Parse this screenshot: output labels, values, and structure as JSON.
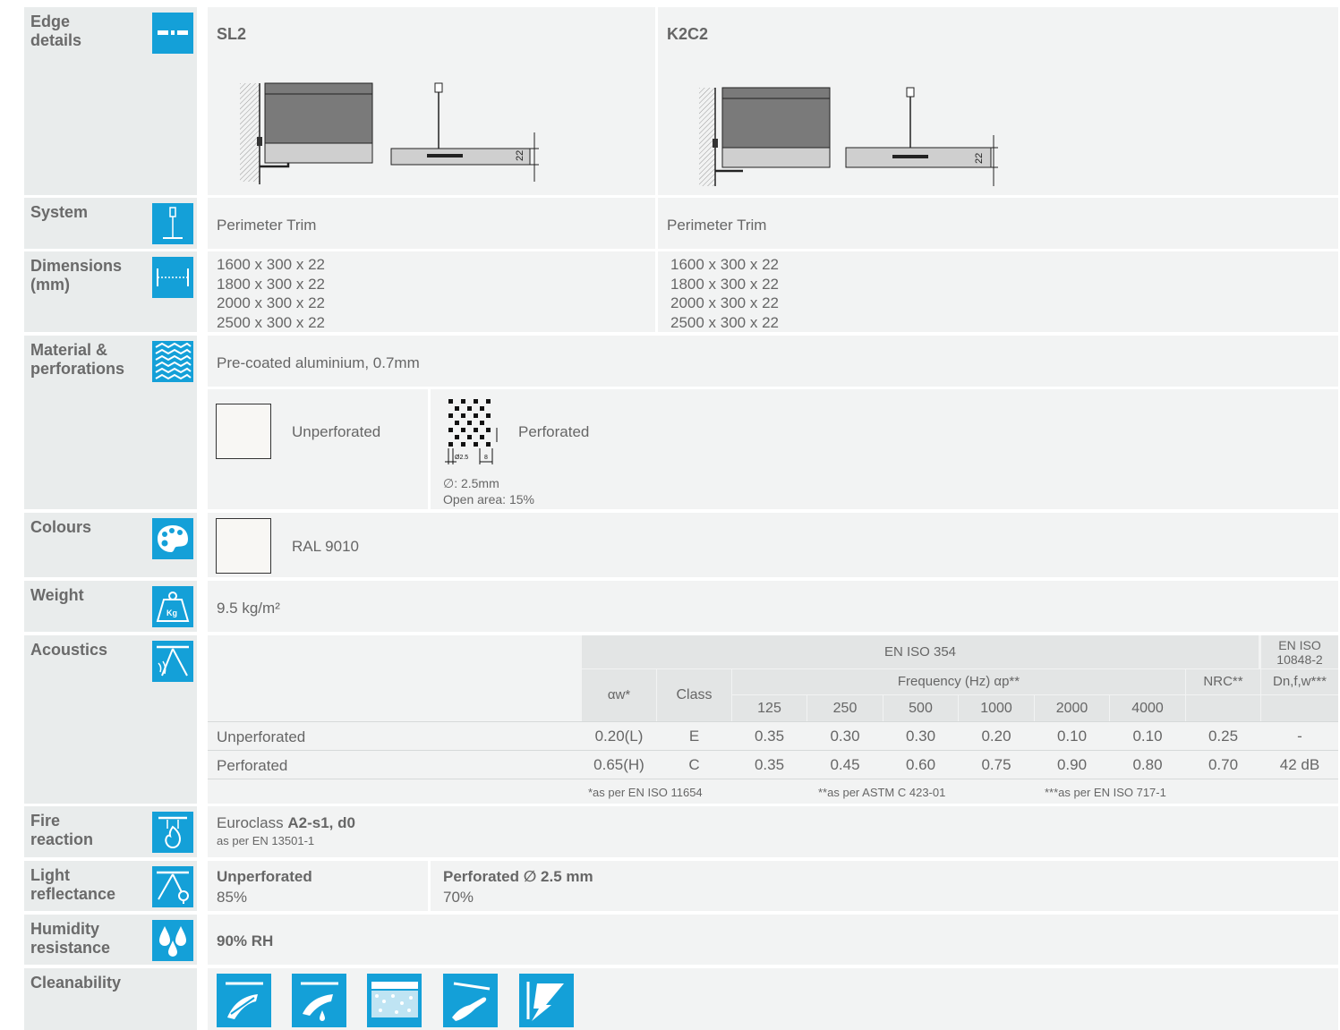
{
  "rows": {
    "edge": {
      "label": "Edge\ndetails",
      "icon": "edge-icon"
    },
    "system": {
      "label": "System",
      "icon": "hanger-icon"
    },
    "dimensions": {
      "label": "Dimensions\n(mm)",
      "icon": "ruler-icon"
    },
    "material": {
      "label": "Material &\nperforations",
      "icon": "perforation-pattern-icon"
    },
    "colours": {
      "label": "Colours",
      "icon": "palette-icon"
    },
    "weight": {
      "label": "Weight",
      "icon": "weight-kg-icon"
    },
    "acoustics": {
      "label": "Acoustics",
      "icon": "acoustics-icon"
    },
    "fire": {
      "label": "Fire\nreaction",
      "icon": "fire-icon"
    },
    "light": {
      "label": "Light\nreflectance",
      "icon": "light-icon"
    },
    "humidity": {
      "label": "Humidity\nresistance",
      "icon": "drops-icon"
    },
    "cleanability": {
      "label": "Cleanability"
    }
  },
  "edge": {
    "sl2": {
      "title": "SL2",
      "dim": "22"
    },
    "k2c2": {
      "title": "K2C2",
      "dim": "22"
    }
  },
  "system": {
    "sl2": "Perimeter Trim",
    "k2c2": "Perimeter Trim"
  },
  "dimensions": {
    "sl2": [
      "1600 x 300 x 22",
      "1800 x 300 x 22",
      "2000 x 300 x 22",
      "2500 x 300 x 22"
    ],
    "k2c2": [
      "1600 x 300 x 22",
      "1800 x 300 x 22",
      "2000 x 300 x 22",
      "2500 x 300 x 22"
    ]
  },
  "material": {
    "text": "Pre-coated aluminium, 0.7mm",
    "unperforated": "Unperforated",
    "perforated": "Perforated",
    "diameter": "∅: 2.5mm",
    "open_area": "Open area: 15%",
    "dim_d": "Ø2.5",
    "dim_pitch": "8"
  },
  "colours": {
    "name": "RAL 9010",
    "swatch": "#f8f7f4"
  },
  "weight": {
    "value": "9.5 kg/m²"
  },
  "acoustics": {
    "standard_354": "EN ISO 354",
    "standard_10848": "EN ISO\n10848-2",
    "alpha_w": "αw*",
    "class": "Class",
    "frequency": "Frequency (Hz) αp**",
    "nrc": "NRC**",
    "dnfw": "Dn,f,w***",
    "freqs": [
      "125",
      "250",
      "500",
      "1000",
      "2000",
      "4000"
    ],
    "rows": [
      {
        "name": "Unperforated",
        "aw": "0.20(L)",
        "cls": "E",
        "vals": [
          "0.35",
          "0.30",
          "0.30",
          "0.20",
          "0.10",
          "0.10"
        ],
        "nrc": "0.25",
        "dnfw": "-"
      },
      {
        "name": "Perforated",
        "aw": "0.65(H)",
        "cls": "C",
        "vals": [
          "0.35",
          "0.45",
          "0.60",
          "0.75",
          "0.90",
          "0.80"
        ],
        "nrc": "0.70",
        "dnfw": "42 dB"
      }
    ],
    "foot1": "*as per EN ISO 11654",
    "foot2": "**as per ASTM C 423-01",
    "foot3": "***as per EN ISO 717-1"
  },
  "fire": {
    "prefix": "Euroclass ",
    "value": "A2-s1, d0",
    "sub": "as per EN 13501-1"
  },
  "light": {
    "unperf_label": "Unperforated",
    "unperf_value": "85%",
    "perf_label": "Perforated ∅ 2.5 mm",
    "perf_value": "70%"
  },
  "humidity": {
    "value": "90% RH"
  },
  "cleanability": {
    "icons": [
      "dry-cloth-icon",
      "damp-cloth-icon",
      "brush-icon",
      "hand-wipe-icon",
      "impact-icon"
    ]
  },
  "colors": {
    "accent": "#14a0d8",
    "label_bg": "#e9ecec",
    "cell_bg": "#f2f3f3",
    "header_bg": "#e3e5e5"
  }
}
